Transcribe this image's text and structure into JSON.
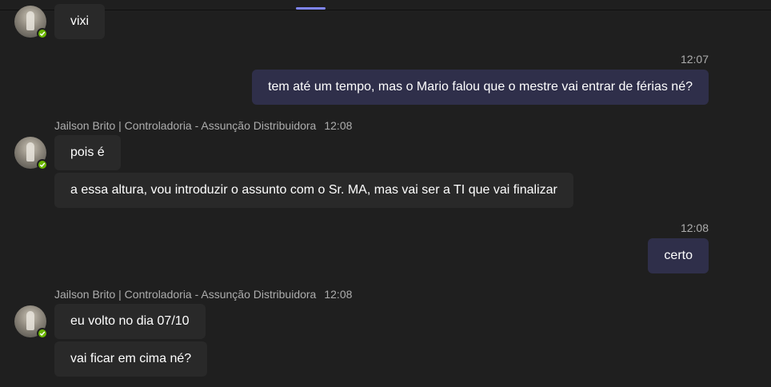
{
  "conversation": {
    "messages": [
      {
        "direction": "in",
        "text": "vixi"
      },
      {
        "direction": "out",
        "time": "12:07",
        "text": "tem até um tempo, mas o Mario falou que o mestre vai entrar de férias né?"
      },
      {
        "direction": "in",
        "sender": "Jailson Brito | Controladoria - Assunção Distribuidora",
        "time": "12:08",
        "texts": [
          "pois é",
          "a essa altura, vou introduzir o assunto com o Sr. MA, mas vai ser a TI que vai finalizar"
        ]
      },
      {
        "direction": "out",
        "time": "12:08",
        "text": "certo"
      },
      {
        "direction": "in",
        "sender": "Jailson Brito | Controladoria - Assunção Distribuidora",
        "time": "12:08",
        "texts": [
          "eu volto no dia 07/10",
          "vai ficar em cima né?"
        ]
      }
    ]
  },
  "presence": {
    "status": "available",
    "color": "#6bb700",
    "icon": "check-icon"
  },
  "colors": {
    "background": "#1f1f1f",
    "incoming_bubble": "#292929",
    "outgoing_bubble": "#2f2f4a",
    "accent": "#7f85f5",
    "meta_text": "#adadad"
  }
}
